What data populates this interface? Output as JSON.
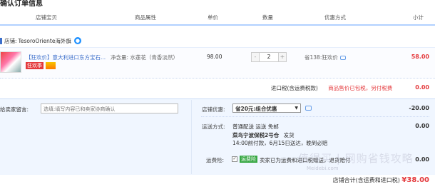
{
  "title": "确认订单信息",
  "columns": [
    "店铺宝贝",
    "商品属性",
    "单价",
    "数量",
    "优惠方式",
    "小计"
  ],
  "shop": {
    "label": "店铺:",
    "name": "TesoroOriente海外旗"
  },
  "item": {
    "title": "【狂欢价】意大利进口东方宝石...",
    "tag": "狂欢季",
    "attribute": "净含量: 水莲花（青香淡然）",
    "price": "98.00",
    "qty_minus": "-",
    "qty": "2",
    "qty_plus": "+",
    "promo": "省138:狂欢价",
    "subtotal": "58.00"
  },
  "tax": {
    "label": "进口税(含运费税款)",
    "note": "商品售价已包税，另付税费",
    "value": "0.00"
  },
  "message": {
    "label": "给卖家留言:",
    "placeholder": "选填:填写内容已和卖家协商确认"
  },
  "shop_discount": {
    "label": "店铺优惠:",
    "selected": "省20元:组合优惠",
    "value": "-20.00"
  },
  "shipping": {
    "label": "运送方式:",
    "method": "普通配送 运送 免邮",
    "warehouse": "菜鸟宁波保税2号仓",
    "warehouse_suffix": "发货",
    "eta": "14:00前付款，6月15日送达，晚到必赔",
    "value": "0.00"
  },
  "insurance": {
    "label": "运费险:",
    "checkbox": "✓",
    "tag": "运费险",
    "text": "卖家已为运费和进口税赠送，退货赔付",
    "value": "0.00"
  },
  "total": {
    "label": "店铺合计(含运费和进口税)",
    "value": "¥38.00"
  },
  "watermark": {
    "main": "值得买 | 网购省钱攻略",
    "sub": "Meidebi.com"
  }
}
